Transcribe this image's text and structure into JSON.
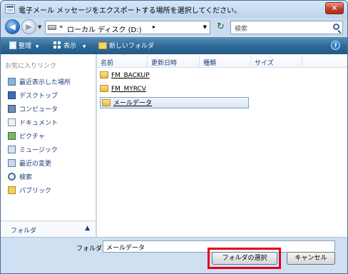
{
  "window": {
    "title": "電子メール メッセージをエクスポートする場所を選択してください。",
    "close_glyph": "✕"
  },
  "address": {
    "back_glyph": "◀",
    "forward_glyph": "▶",
    "overflow_glyph": "«",
    "path_text": "ローカル ディスク (D:)",
    "path_chevron": "▸",
    "dropdown_glyph": "▼",
    "refresh_glyph": "↻",
    "search_placeholder": "検索"
  },
  "toolbar": {
    "organize_label": "整理",
    "views_label": "表示",
    "new_folder_label": "新しいフォルダ",
    "dropdown_glyph": "▼",
    "help_glyph": "?"
  },
  "nav": {
    "favorites_title": "お気に入りリンク",
    "items": [
      {
        "label": "最近表示した場所",
        "icon": "recent-places-icon"
      },
      {
        "label": "デスクトップ",
        "icon": "desktop-icon"
      },
      {
        "label": "コンピュータ",
        "icon": "computer-icon"
      },
      {
        "label": "ドキュメント",
        "icon": "documents-icon"
      },
      {
        "label": "ピクチャ",
        "icon": "pictures-icon"
      },
      {
        "label": "ミュージック",
        "icon": "music-icon"
      },
      {
        "label": "最近の変更",
        "icon": "recent-changes-icon"
      },
      {
        "label": "検索",
        "icon": "search-folder-icon"
      },
      {
        "label": "パブリック",
        "icon": "public-folder-icon"
      }
    ],
    "folders_label": "フォルダ",
    "folders_toggle": "▲"
  },
  "filelist": {
    "columns": [
      "名前",
      "更新日時",
      "種類",
      "サイズ"
    ],
    "sort_glyph": "^",
    "rows": [
      {
        "name": "FM_BACKUP",
        "selected": false
      },
      {
        "name": "FM_MYRCV",
        "selected": false
      },
      {
        "name": "メールデータ",
        "selected": true
      }
    ]
  },
  "bottom": {
    "folder_label": "フォルダ:",
    "folder_value": "メールデータ",
    "select_button": "フォルダの選択",
    "cancel_button": "キャンセル"
  },
  "colors": {
    "toolbar": "#2f6a98",
    "highlight": "#e50012",
    "link_text": "#1b3f75"
  }
}
